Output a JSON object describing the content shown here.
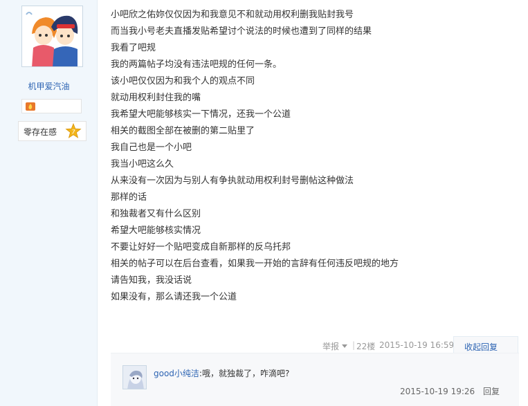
{
  "author": {
    "username": "机甲爱汽油",
    "level_name": "零存在感",
    "level_number": "7",
    "avatar_icon": "anime-avatar-icon",
    "badge_icon": "flame-badge-icon"
  },
  "post": {
    "lines": [
      "小吧欣之佑妳仅仅因为和我意见不和就动用权利删我贴封我号",
      "而当我小号老夫直播发贴希望讨个说法的时候也遭到了同样的结果",
      "我看了吧规",
      "我的两篇帖子均没有违法吧规的任何一条。",
      "该小吧仅仅因为和我个人的观点不同",
      "就动用权利封住我的嘴",
      "我希望大吧能够核实一下情况，还我一个公道",
      "相关的截图全部在被删的第二贴里了",
      "我自己也是一个小吧",
      "我当小吧这么久",
      "从来没有一次因为与别人有争执就动用权利封号删帖这种做法",
      "那样的话",
      "和独裁者又有什么区别",
      "希望大吧能够核实情况",
      "不要让好好一个贴吧变成自新那样的反乌托邦",
      "相关的帖子可以在后台查看，如果我一开始的言辞有任何违反吧规的地方",
      "请告知我，我没话说",
      "如果没有，那么请还我一个公道"
    ],
    "tail": {
      "report_label": "举报",
      "separator": "|",
      "floor": "22楼",
      "date": "2015-10-19 16:59",
      "collapse_label": "收起回复"
    }
  },
  "replies": [
    {
      "username": "good小纯洁",
      "colon": ":",
      "text": "哦，就独裁了，咋滴吧?",
      "date": "2015-10-19 19:26",
      "reply_label": "回复",
      "avatar_icon": "anime-avatar-icon"
    }
  ],
  "colors": {
    "link": "#2d64b3",
    "sidebar_bg": "#f1f7fc",
    "reply_bg": "#f7f8fa"
  }
}
